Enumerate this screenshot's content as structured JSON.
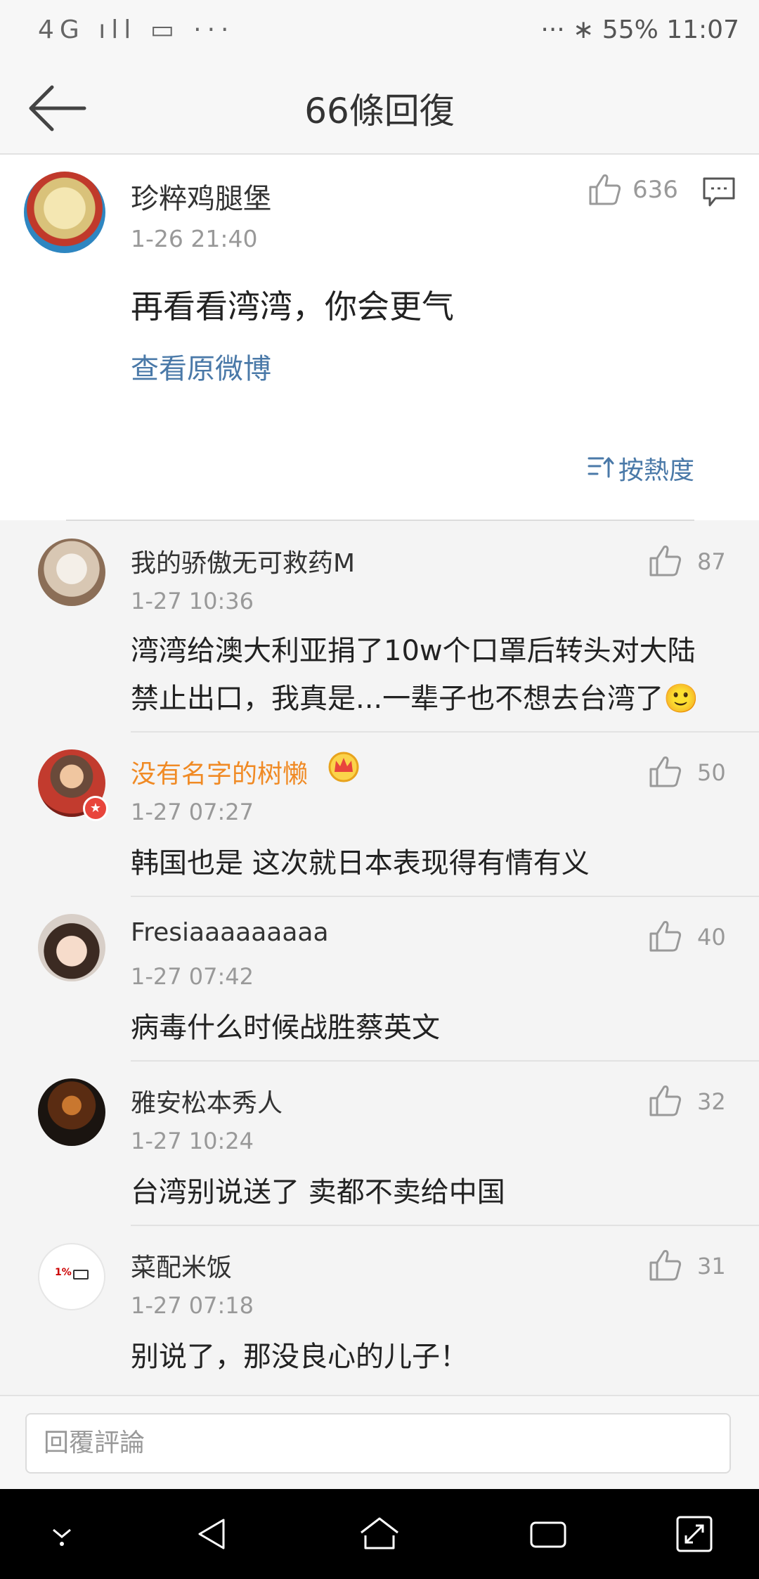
{
  "status_bar": {
    "left": "4G ıll ▭ ···",
    "right": "··· ∗ 55% 11:07"
  },
  "header": {
    "title": "66條回復"
  },
  "main_post": {
    "author": "珍粹鸡腿堡",
    "time": "1-26 21:40",
    "likes": "636",
    "text": "再看看湾湾，你会更气",
    "link": "查看原微博",
    "sort_label": "按熱度"
  },
  "comments": [
    {
      "name": "我的骄傲无可救药M",
      "time": "1-27 10:36",
      "likes": "87",
      "line1": "湾湾给澳大利亚捐了10w个口罩后转头对大陆",
      "line2": "禁止出口，我真是...一辈子也不想去台湾了🙂"
    },
    {
      "name": "没有名字的树懒",
      "time": "1-27 07:27",
      "likes": "50",
      "line1": "韩国也是    这次就日本表现得有情有义"
    },
    {
      "name": "Fresiaaaaaaaaa",
      "time": "1-27 07:42",
      "likes": "40",
      "line1": "病毒什么时候战胜蔡英文"
    },
    {
      "name": "雅安松本秀人",
      "time": "1-27 10:24",
      "likes": "32",
      "line1": "台湾别说送了 卖都不卖给中国"
    },
    {
      "name": "菜配米饭",
      "time": "1-27 07:18",
      "likes": "31",
      "line1": "别说了，那没良心的儿子！"
    }
  ],
  "reply": {
    "placeholder": "回覆評論"
  },
  "avatar_badge": "1%",
  "colors": {
    "link": "#4a79a8",
    "vip_name": "#f08a24",
    "background": "#f4f4f4"
  }
}
